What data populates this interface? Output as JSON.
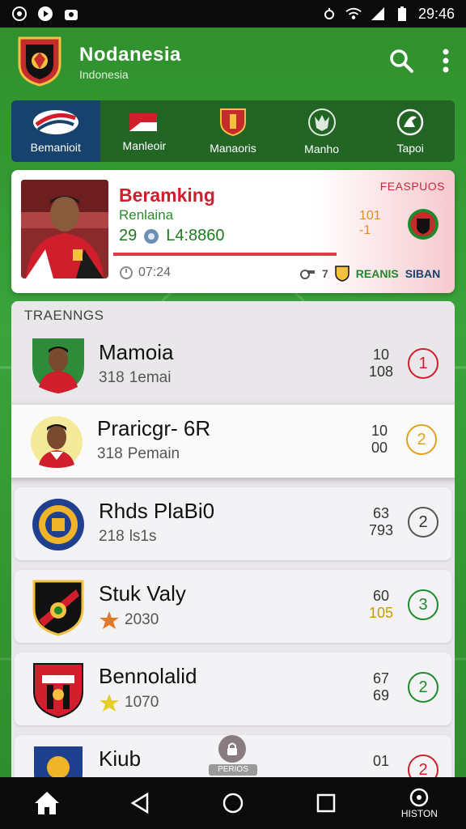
{
  "status_bar": {
    "time": "29:46"
  },
  "app": {
    "title": "Nodanesia",
    "subtitle": "Indonesia"
  },
  "tabs": [
    {
      "label": "Bemanioit",
      "active": true
    },
    {
      "label": "Manleoir",
      "active": false
    },
    {
      "label": "Manaoris",
      "active": false
    },
    {
      "label": "Manho",
      "active": false
    },
    {
      "label": "Tapoi",
      "active": false
    }
  ],
  "featured": {
    "label": "FEASPUOS",
    "name": "Beramking",
    "subtitle": "Renlaina",
    "stat_a": "29",
    "stat_b": "L4:8860",
    "score_top": "101",
    "score_bottom": "-1",
    "footer_time": "07:24",
    "footer_num": "7",
    "footer_team_a": "REANIS",
    "footer_team_b": "SIBAN"
  },
  "list": {
    "heading": "TRAENNGS",
    "rows": [
      {
        "name": "Mamoia",
        "meta_num": "318",
        "meta_text": "1emai",
        "num_top": "10",
        "num_bottom": "108",
        "rank": "1",
        "rank_color": "#d11e2d"
      },
      {
        "name": "Praricgr- 6R",
        "meta_num": "318",
        "meta_text": "Pemain",
        "num_top": "10",
        "num_bottom": "00",
        "rank": "2",
        "rank_color": "#e0a21b"
      },
      {
        "name": "Rhds PlaBi0",
        "meta_num": "218",
        "meta_text": "ls1s",
        "num_top": "63",
        "num_bottom": "793",
        "rank": "2",
        "rank_color": "#555555"
      },
      {
        "name": "Stuk Valy",
        "meta_num": "",
        "meta_text": "2030",
        "num_top": "60",
        "num_bottom": "105",
        "rank": "3",
        "rank_color": "#1e8a2c"
      },
      {
        "name": "Bennolalid",
        "meta_num": "",
        "meta_text": "1070",
        "num_top": "67",
        "num_bottom": "69",
        "rank": "2",
        "rank_color": "#1e8a2c"
      },
      {
        "name": "Kiub",
        "meta_num": "",
        "meta_text": "",
        "num_top": "01",
        "num_bottom": "",
        "rank": "2",
        "rank_color": "#d11e2d"
      }
    ]
  },
  "fab_label": "PERIOS",
  "nav": {
    "last_label": "HISTON"
  }
}
